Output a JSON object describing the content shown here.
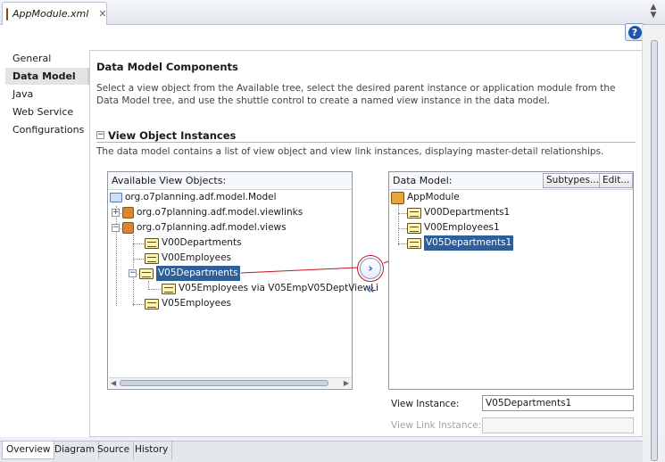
{
  "tab": {
    "name": "AppModule.xml",
    "close": "✕"
  },
  "help": "?",
  "nav": [
    "General",
    "Data Model",
    "Java",
    "Web Service",
    "Configurations"
  ],
  "nav_selected": "Data Model",
  "header": {
    "title": "Data Model Components",
    "description": "Select a view object from the Available tree, select the desired parent instance or application module from the Data Model tree, and use the shuttle control to create a named view instance in the data model."
  },
  "section": {
    "toggle": "−",
    "title": "View Object Instances",
    "description": "The data model contains a list of view object and view link instances, displaying master-detail relationships."
  },
  "available": {
    "label": "Available View Objects:",
    "root": "org.o7planning.adf.model.Model",
    "items": [
      "org.o7planning.adf.model.viewlinks",
      "org.o7planning.adf.model.views",
      "V00Departments",
      "V00Employees",
      "V05Departments",
      "V05Employees via V05EmpV05DeptViewLi",
      "V05Employees"
    ],
    "selected": "V05Departments"
  },
  "datamodel": {
    "label": "Data Model:",
    "subtypes_button": "Subtypes...",
    "edit_button": "Edit...",
    "root": "AppModule",
    "items": [
      "V00Departments1",
      "V00Employees1",
      "V05Departments1"
    ],
    "selected": "V05Departments1"
  },
  "shuttle": {
    "add": "›",
    "remove": "«"
  },
  "view_instance": {
    "label": "View Instance:",
    "value": "V05Departments1"
  },
  "view_link_instance": {
    "label": "View Link Instance:",
    "value": ""
  },
  "bottom_tabs": [
    "Overview",
    "Diagram",
    "Source",
    "History"
  ],
  "bottom_tab_selected": "Overview",
  "colors": {
    "selection": "#2e5f98",
    "annotation": "#c4161c",
    "shuttle_arrow": "#2a5aa8"
  }
}
